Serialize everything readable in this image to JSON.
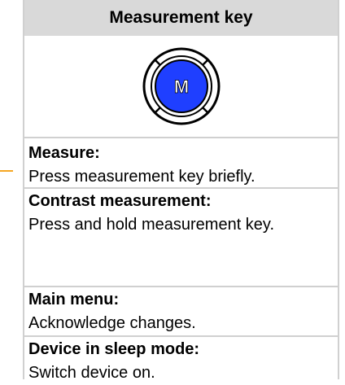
{
  "header": {
    "title": "Measurement key"
  },
  "key_icon": {
    "letter": "M",
    "fill_color": "#1f3fff",
    "ring_color": "#000000"
  },
  "pointer_color": "#f5a623",
  "sections": [
    {
      "title": "Measure:",
      "description": "Press measurement key briefly."
    },
    {
      "title": "Contrast measurement:",
      "description": "Press and hold measurement key."
    },
    {
      "title": "Main menu:",
      "description": "Acknowledge changes."
    },
    {
      "title": "Device in sleep mode:",
      "description": "Switch device on."
    }
  ]
}
